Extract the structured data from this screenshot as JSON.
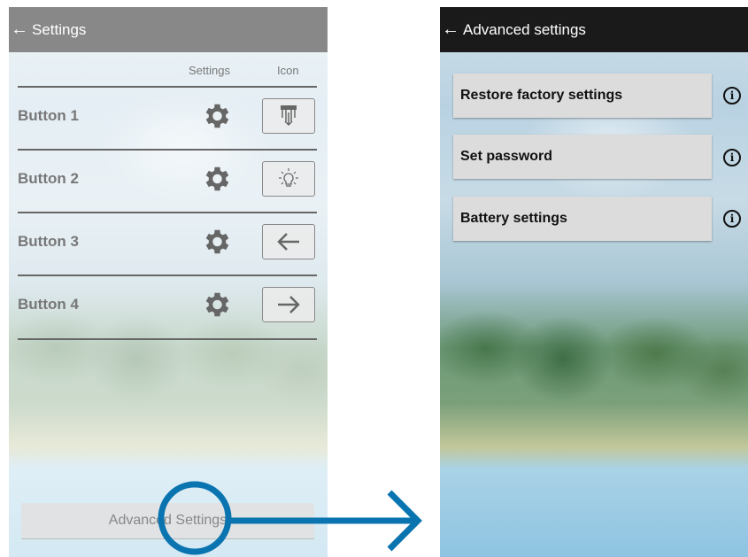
{
  "left_screen": {
    "title": "Settings",
    "back_glyph": "←",
    "column_headers": {
      "settings": "Settings",
      "icon": "Icon"
    },
    "rows": [
      {
        "label": "Button 1",
        "icon": "roller-shutter-down-icon"
      },
      {
        "label": "Button 2",
        "icon": "light-bulb-icon"
      },
      {
        "label": "Button 3",
        "icon": "arrow-left-icon"
      },
      {
        "label": "Button 4",
        "icon": "arrow-right-icon"
      }
    ],
    "advanced_button": "Advanced Settings"
  },
  "right_screen": {
    "title": "Advanced settings",
    "back_glyph": "←",
    "items": [
      {
        "label": "Restore factory settings",
        "info_icon": "info-icon"
      },
      {
        "label": "Set password",
        "info_icon": "info-icon"
      },
      {
        "label": "Battery settings",
        "info_icon": "info-icon"
      }
    ]
  },
  "colors": {
    "left_appbar": "#888888",
    "right_appbar": "#1a1a1a",
    "annotation": "#0a74b0"
  }
}
